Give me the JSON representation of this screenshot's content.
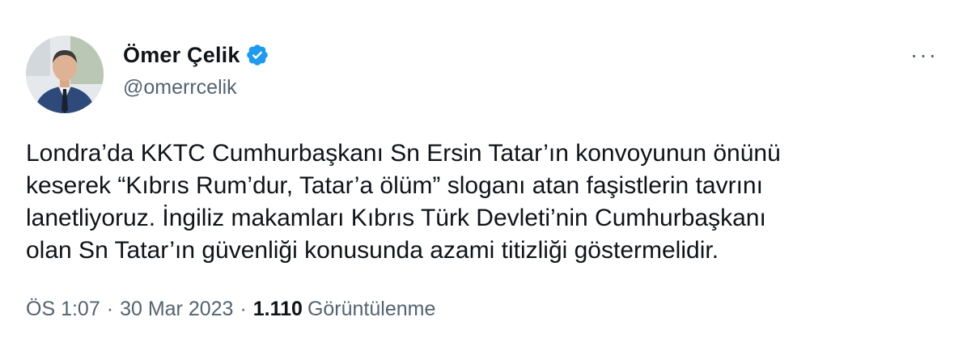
{
  "user": {
    "display_name": "Ömer Çelik",
    "handle": "@omerrcelik",
    "verified": true,
    "verified_color": "#1d9bf0"
  },
  "tweet": {
    "lines": [
      "Londra’da KKTC Cumhurbaşkanı Sn Ersin Tatar’ın konvoyunun önünü",
      "keserek “Kıbrıs Rum’dur, Tatar’a ölüm” sloganı atan faşistlerin tavrını",
      "lanetliyoruz. İngiliz makamları Kıbrıs Türk Devleti’nin Cumhurbaşkanı",
      "olan Sn Tatar’ın güvenliği konusunda  azami titizliği göstermelidir."
    ]
  },
  "meta": {
    "time": "ÖS 1:07",
    "separator": "·",
    "date": "30 Mar 2023",
    "views_count": "1.110",
    "views_label": "Görüntülenme"
  },
  "menu": {
    "more_glyph": "···",
    "icon": "more-horizontal-icon"
  }
}
